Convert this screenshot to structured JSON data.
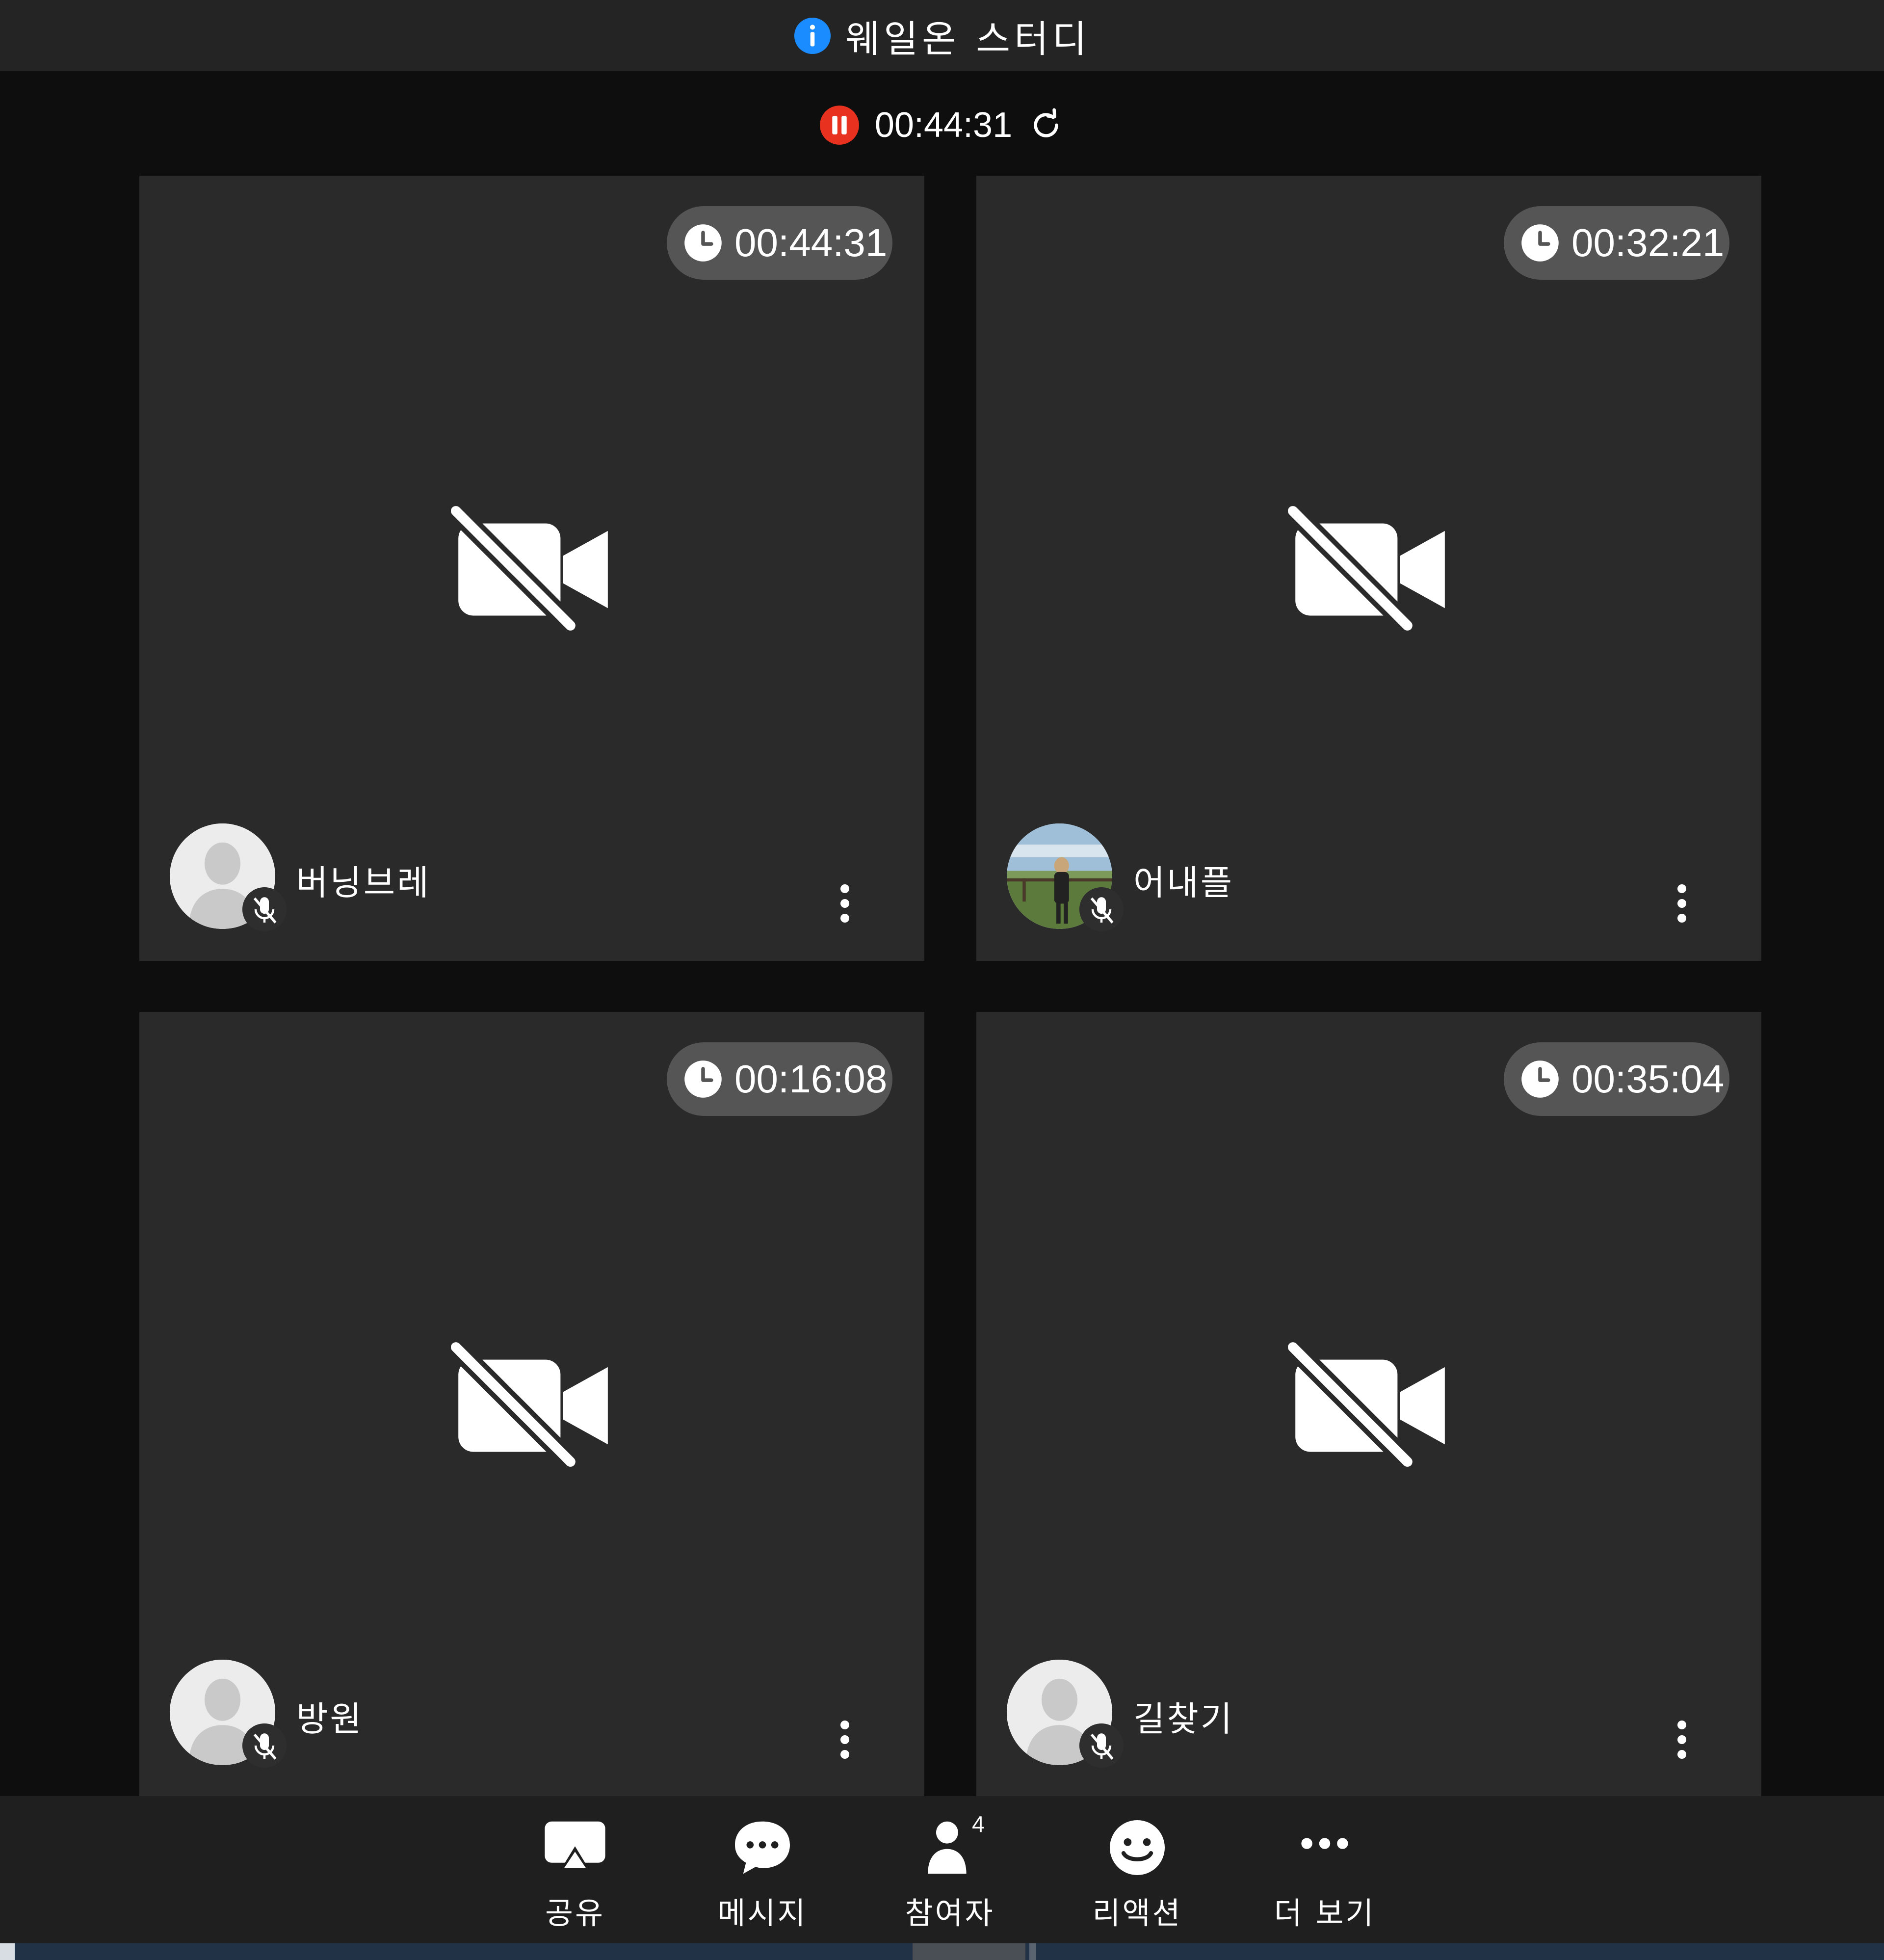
{
  "window": {
    "title": "웨일온 스터디"
  },
  "recording": {
    "elapsed": "00:44:31"
  },
  "participants": [
    {
      "name": "버닝브레",
      "duration": "00:44:31",
      "avatar": "default-avatar"
    },
    {
      "name": "어내플",
      "duration": "00:32:21",
      "avatar": "photo-avatar"
    },
    {
      "name": "방원",
      "duration": "00:16:08",
      "avatar": "default-avatar"
    },
    {
      "name": "길찾기",
      "duration": "00:35:04",
      "avatar": "default-avatar"
    }
  ],
  "toolbar": {
    "share_label": "공유",
    "message_label": "메시지",
    "participants_label": "참여자",
    "participants_count": "4",
    "reaction_label": "리액션",
    "more_label": "더 보기"
  },
  "colors": {
    "accent_info": "#1a8cff",
    "recording_red": "#e8321f",
    "tile_bg": "#2a2a2a",
    "timer_pill": "#555555"
  }
}
